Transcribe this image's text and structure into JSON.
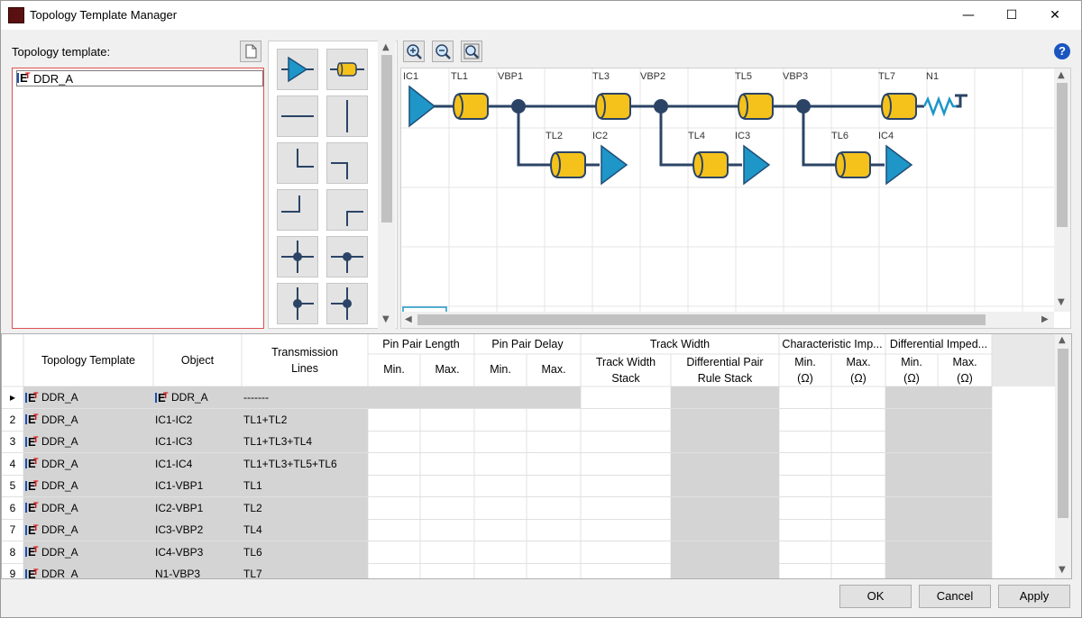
{
  "window": {
    "title": "Topology Template Manager",
    "minimize": "—",
    "maximize": "☐",
    "close": "✕"
  },
  "left_panel": {
    "label": "Topology template:",
    "tree_items": [
      "DDR_A"
    ]
  },
  "canvas_labels": {
    "ic1": "IC1",
    "tl1": "TL1",
    "vbp1": "VBP1",
    "tl3": "TL3",
    "vbp2": "VBP2",
    "tl5": "TL5",
    "vbp3": "VBP3",
    "tl7": "TL7",
    "n1": "N1",
    "tl2": "TL2",
    "ic2": "IC2",
    "tl4": "TL4",
    "ic3": "IC3",
    "tl6": "TL6",
    "ic4": "IC4"
  },
  "table": {
    "headers": {
      "topology_template": "Topology Template",
      "object": "Object",
      "transmission_lines": "Transmission Lines",
      "pin_pair_length": "Pin Pair Length",
      "pin_pair_delay": "Pin Pair Delay",
      "track_width": "Track Width",
      "track_width_stack": "Track Width Stack",
      "diff_pair_rule_stack": "Differential Pair Rule Stack",
      "char_imp": "Characteristic Imp...",
      "diff_imp": "Differential Imped...",
      "min": "Min.",
      "max": "Max.",
      "min_ohm": "Min. (Ω)",
      "max_ohm": "Max. (Ω)"
    },
    "rows": [
      {
        "num": "▸",
        "template": "DDR_A",
        "object": "DDR_A",
        "lines": "-------"
      },
      {
        "num": "2",
        "template": "DDR_A",
        "object": "IC1-IC2",
        "lines": "TL1+TL2"
      },
      {
        "num": "3",
        "template": "DDR_A",
        "object": "IC1-IC3",
        "lines": "TL1+TL3+TL4"
      },
      {
        "num": "4",
        "template": "DDR_A",
        "object": "IC1-IC4",
        "lines": "TL1+TL3+TL5+TL6"
      },
      {
        "num": "5",
        "template": "DDR_A",
        "object": "IC1-VBP1",
        "lines": "TL1"
      },
      {
        "num": "6",
        "template": "DDR_A",
        "object": "IC2-VBP1",
        "lines": "TL2"
      },
      {
        "num": "7",
        "template": "DDR_A",
        "object": "IC3-VBP2",
        "lines": "TL4"
      },
      {
        "num": "8",
        "template": "DDR_A",
        "object": "IC4-VBP3",
        "lines": "TL6"
      },
      {
        "num": "9",
        "template": "DDR_A",
        "object": "N1-VBP3",
        "lines": "TL7"
      }
    ]
  },
  "buttons": {
    "ok": "OK",
    "cancel": "Cancel",
    "apply": "Apply"
  },
  "colors": {
    "accent": "#1e96c8",
    "cylinder": "#f5c21b",
    "wire": "#2b4466"
  }
}
